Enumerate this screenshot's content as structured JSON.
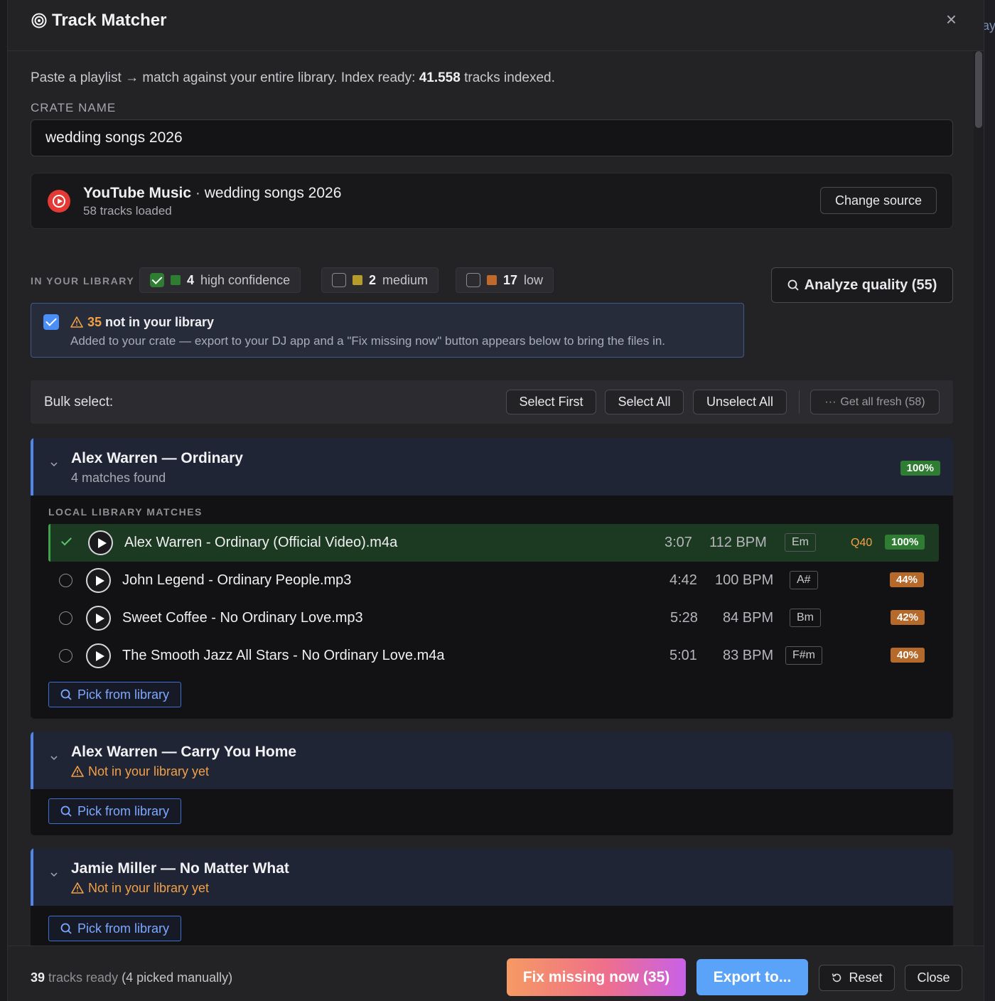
{
  "window": {
    "title": "Track Matcher",
    "peek_text": "ay"
  },
  "intro": {
    "prefix": "Paste a playlist → match against your entire library. Index ready: ",
    "count": "41.558",
    "suffix": " tracks indexed."
  },
  "crate": {
    "label": "CRATE NAME",
    "value": "wedding songs 2026"
  },
  "source": {
    "brand": "YouTube Music",
    "separator": " · ",
    "playlist": "wedding songs 2026",
    "tracks_loaded": "58 tracks loaded",
    "change_label": "Change source"
  },
  "library": {
    "label": "IN YOUR LIBRARY",
    "chips": [
      {
        "count": "4",
        "label": "high confidence",
        "checked": true,
        "color": "#2e7d32"
      },
      {
        "count": "2",
        "label": "medium",
        "checked": false,
        "color": "#b59a2c"
      },
      {
        "count": "17",
        "label": "low",
        "checked": false,
        "color": "#c0692b"
      }
    ],
    "analyze_label": "Analyze quality (55)"
  },
  "missing": {
    "count": "35",
    "title": " not in your library",
    "description": "Added to your crate — export to your DJ app and a \"Fix missing now\" button appears below to bring the files in."
  },
  "bulk": {
    "label": "Bulk select:",
    "select_first": "Select First",
    "select_all": "Select All",
    "unselect_all": "Unselect All",
    "fresh": "Get all fresh (58)"
  },
  "groups": [
    {
      "title": "Alex Warren — Ordinary",
      "subtitle": "4 matches found",
      "score": "100%",
      "section_label": "LOCAL LIBRARY MATCHES",
      "matches": [
        {
          "file": "Alex Warren - Ordinary (Official Video).m4a",
          "duration": "3:07",
          "bpm": "112 BPM",
          "key": "Em",
          "quality": "Q40",
          "score": "100%",
          "selected": true
        },
        {
          "file": "John Legend - Ordinary People.mp3",
          "duration": "4:42",
          "bpm": "100 BPM",
          "key": "A#",
          "score": "44%",
          "selected": false
        },
        {
          "file": "Sweet Coffee - No Ordinary Love.mp3",
          "duration": "5:28",
          "bpm": "84 BPM",
          "key": "Bm",
          "score": "42%",
          "selected": false
        },
        {
          "file": "The Smooth Jazz All Stars - No Ordinary Love.m4a",
          "duration": "5:01",
          "bpm": "83 BPM",
          "key": "F#m",
          "score": "40%",
          "selected": false
        }
      ],
      "pick_label": "Pick from library"
    },
    {
      "title": "Alex Warren — Carry You Home",
      "subtitle": "Not in your library yet",
      "pick_label": "Pick from library"
    },
    {
      "title": "Jamie Miller — No Matter What",
      "subtitle": "Not in your library yet",
      "pick_label": "Pick from library"
    }
  ],
  "footer": {
    "ready_count": "39",
    "ready_label": " tracks ready ",
    "manual": "(4 picked manually)",
    "fix_label": "Fix missing now (35)",
    "export_label": "Export to...",
    "reset_label": "Reset",
    "close_label": "Close"
  },
  "colors": {
    "accent_blue": "#4f86e8",
    "success_green": "#2e7d32",
    "warning_orange": "#f3a046",
    "low_orange": "#b56a2c"
  },
  "icons": [
    "target-icon",
    "close-icon",
    "youtube-music-icon",
    "warning-icon",
    "search-icon",
    "chevron-down-icon",
    "play-icon",
    "checkmark-icon",
    "reset-icon",
    "ellipsis-icon"
  ]
}
